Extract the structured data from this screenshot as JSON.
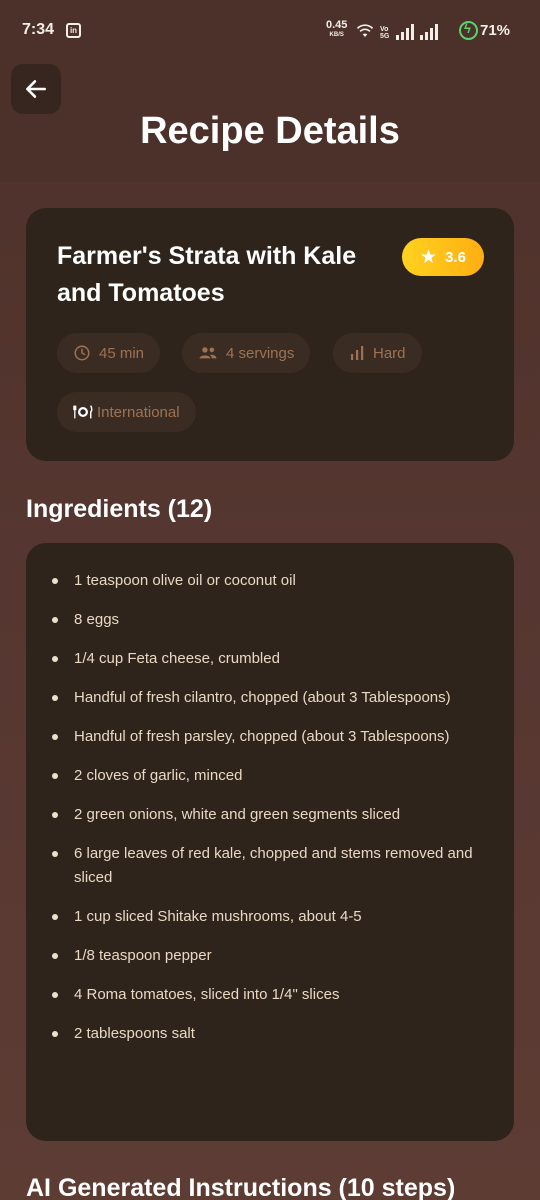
{
  "status_bar": {
    "time": "7:34",
    "net_speed": "0.45",
    "net_unit": "KB/S",
    "volte": "VoLTE",
    "battery": "71%"
  },
  "header": {
    "title": "Recipe Details",
    "back_icon": "arrow-left-icon"
  },
  "recipe": {
    "title": "Farmer's Strata with Kale and Tomatoes",
    "rating": "3.6",
    "time": "45 min",
    "servings": "4 servings",
    "difficulty": "Hard",
    "cuisine": "International"
  },
  "ingredients": {
    "heading": "Ingredients (12)",
    "items": [
      "1 teaspoon olive oil or coconut oil",
      "8 eggs",
      "1/4 cup Feta cheese, crumbled",
      "Handful of fresh cilantro, chopped (about 3 Tablespoons)",
      "Handful of fresh parsley, chopped (about 3 Tablespoons)",
      "2 cloves of garlic, minced",
      "2 green onions, white and green segments sliced",
      "6 large leaves of red kale, chopped and stems removed and sliced",
      "1 cup sliced Shitake mushrooms, about 4-5",
      "1/8 teaspoon pepper",
      "4 Roma tomatoes, sliced into 1/4\" slices",
      "2 tablespoons salt"
    ]
  },
  "instructions": {
    "heading": "AI Generated Instructions (10 steps)"
  },
  "colors": {
    "background": "#553630",
    "card": "#2e241b",
    "chip": "#3a2c22",
    "chip_text": "#9e7253",
    "rating_badge": "#ffc21a"
  }
}
